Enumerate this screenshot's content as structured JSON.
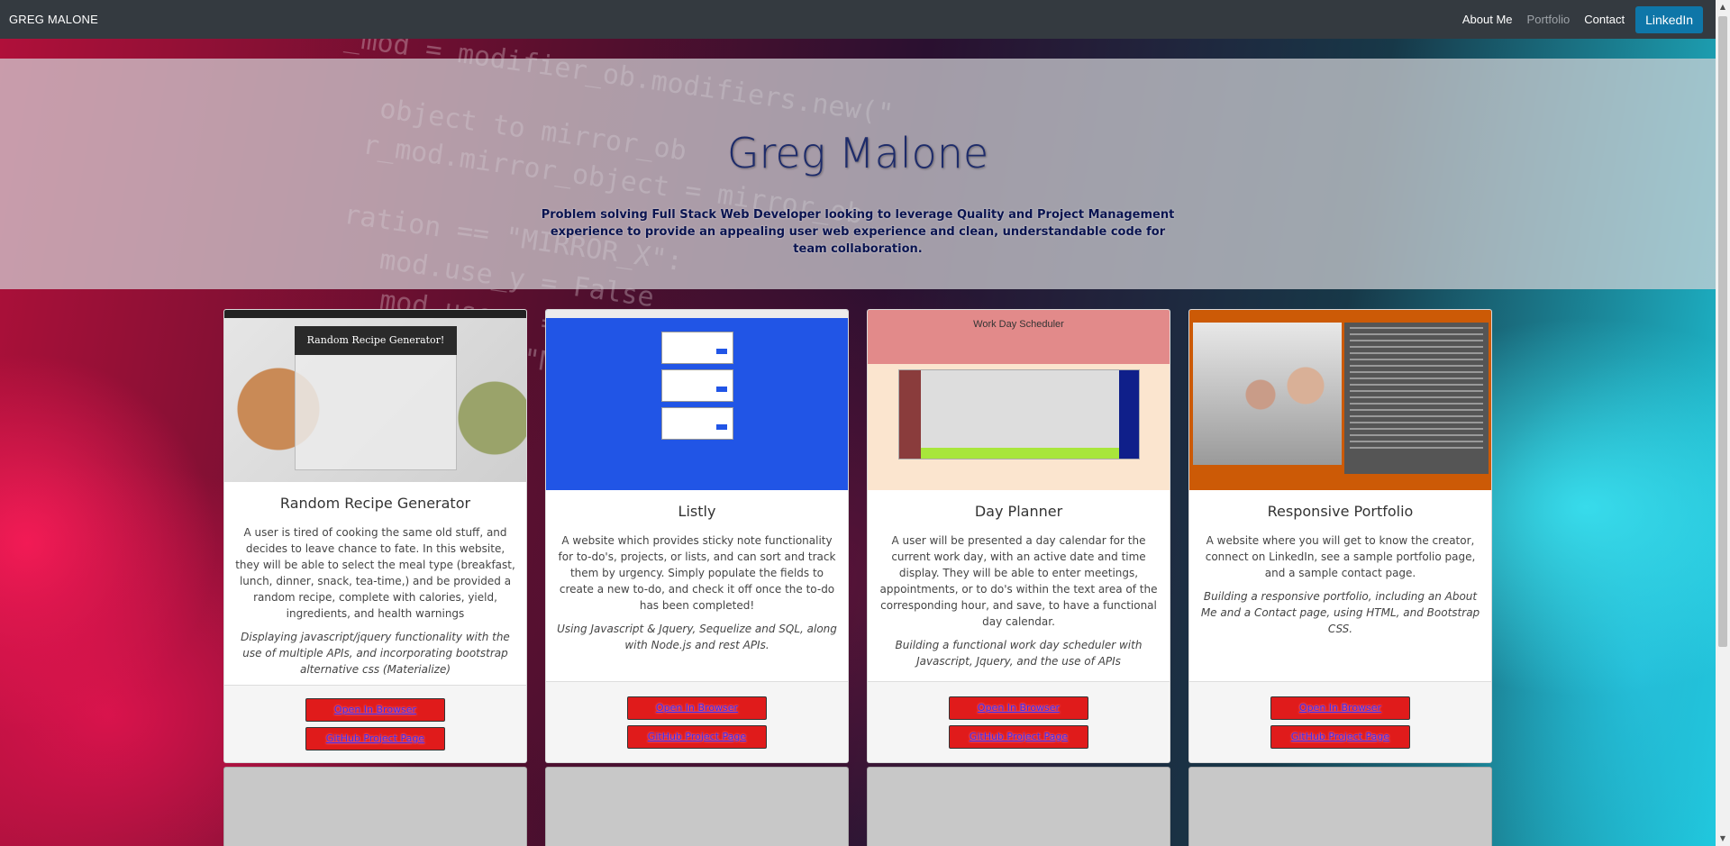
{
  "navbar": {
    "brand": "GREG MALONE",
    "links": [
      {
        "label": "About Me"
      },
      {
        "label": "Portfolio"
      },
      {
        "label": "Contact"
      }
    ],
    "linkedin_label": "LinkedIn"
  },
  "hero": {
    "title": "Greg Malone",
    "tagline": "Problem solving Full Stack Web Developer looking to leverage Quality and Project Management experience to provide an appealing user web experience and clean, understandable code for team collaboration."
  },
  "background_code": [
    "_mod = modifier_ob.modifiers.new(\"",
    "object to mirror_ob",
    "r_mod.mirror_object = mirror_ob",
    "ration == \"MIRROR_X\":",
    "mod.use_y = False",
    "mod.use_z = False",
    "ration == \"MIRROR_Y\":"
  ],
  "thumbs": {
    "recipe_heading": "Random Recipe Generator!",
    "planner_heading": "Work Day Scheduler"
  },
  "projects": [
    {
      "title": "Random Recipe Generator",
      "description": "A user is tired of cooking the same old stuff, and decides to leave chance to fate. In this website, they will be able to select the meal type (breakfast, lunch, dinner, snack, tea-time,) and be provided a random recipe, complete with calories, yield, ingredients, and health warnings",
      "tech": "Displaying javascript/jquery functionality with the use of multiple APIs, and incorporating bootstrap alternative css (Materialize)",
      "open_label": "Open In Browser",
      "github_label": "GitHub Project Page"
    },
    {
      "title": "Listly",
      "description": "A website which provides sticky note functionality for to-do's, projects, or lists, and can sort and track them by urgency. Simply populate the fields to create a new to-do, and check it off once the to-do has been completed!",
      "tech": "Using Javascript & Jquery, Sequelize and SQL, along with Node.js and rest APIs.",
      "open_label": "Open In Browser",
      "github_label": "GitHub Project Page"
    },
    {
      "title": "Day Planner",
      "description": "A user will be presented a day calendar for the current work day, with an active date and time display. They will be able to enter meetings, appointments, or to do's within the text area of the corresponding hour, and save, to have a functional day calendar.",
      "tech": "Building a functional work day scheduler with Javascript, Jquery, and the use of APIs",
      "open_label": "Open In Browser",
      "github_label": "GitHub Project Page"
    },
    {
      "title": "Responsive Portfolio",
      "description": "A website where you will get to know the creator, connect on LinkedIn, see a sample portfolio page, and a sample contact page.",
      "tech": "Building a responsive portfolio, including an About Me and a Contact page, using HTML, and Bootstrap CSS.",
      "open_label": "Open In Browser",
      "github_label": "GitHub Project Page"
    }
  ]
}
